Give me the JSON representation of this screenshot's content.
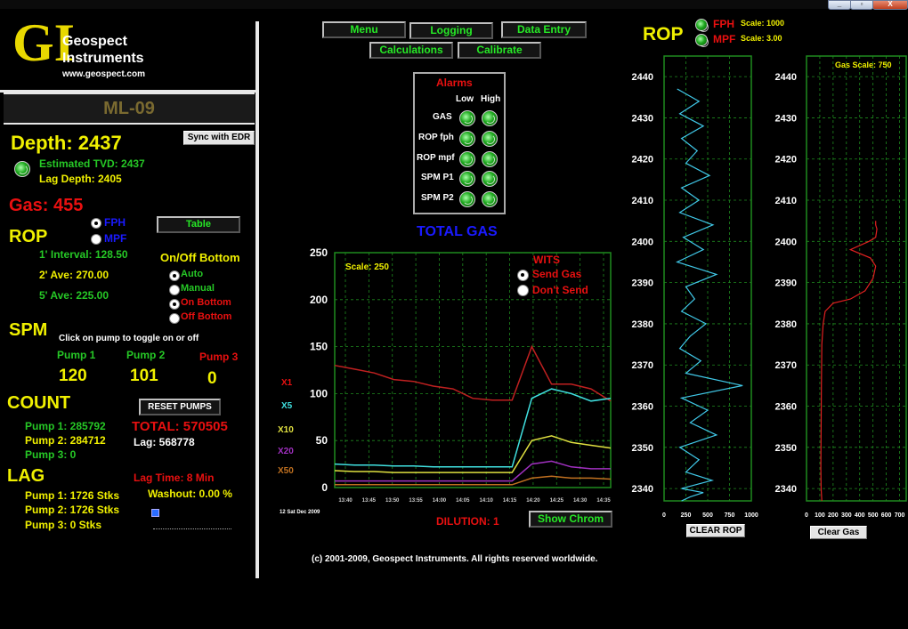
{
  "window_controls": [
    "_",
    "▫",
    "X"
  ],
  "logo": {
    "monogram": "GI",
    "line1": "Geospect",
    "line2": "Instruments",
    "url": "www.geospect.com"
  },
  "well_name": "ML-09",
  "depth": {
    "label": "Depth: 2437",
    "sync_button": "Sync with EDR",
    "estimated_tvd": "Estimated TVD: 2437",
    "lag_depth": "Lag Depth: 2405"
  },
  "gas": {
    "label": "Gas: 455"
  },
  "rop": {
    "title": "ROP",
    "unit_fph": "FPH",
    "unit_mpf": "MPF",
    "table_button": "Table",
    "interval": "1' Interval: 128.50",
    "ave2": "2'  Ave: 270.00",
    "ave5": "5' Ave: 225.00"
  },
  "onoff": {
    "title": "On/Off Bottom",
    "options": [
      "Auto",
      "Manual",
      "On Bottom",
      "Off Bottom"
    ]
  },
  "spm": {
    "title": "SPM",
    "hint": "Click on pump to toggle on or off",
    "pumps": [
      {
        "label": "Pump 1",
        "value": "120"
      },
      {
        "label": "Pump 2",
        "value": "101"
      },
      {
        "label": "Pump 3",
        "value": "0"
      }
    ]
  },
  "count": {
    "title": "COUNT",
    "reset_button": "RESET PUMPS",
    "pump1": "Pump 1: 285792",
    "pump2": "Pump 2: 284712",
    "pump3": "Pump 3: 0",
    "total": "TOTAL: 570505",
    "lag": "Lag: 568778"
  },
  "lag": {
    "title": "LAG",
    "pump1": "Pump 1: 1726 Stks",
    "pump2": "Pump 2: 1726 Stks",
    "pump3": "Pump 3: 0 Stks",
    "lag_time": "Lag Time: 8 Min",
    "washout": "Washout: 0.00 %"
  },
  "menu": {
    "items": [
      "Menu",
      "Logging",
      "Data Entry",
      "Calculations",
      "Calibrate"
    ]
  },
  "alarms": {
    "title": "Alarms",
    "low": "Low",
    "high": "High",
    "rows": [
      "GAS",
      "ROP fph",
      "ROP mpf",
      "SPM P1",
      "SPM P2"
    ]
  },
  "total_gas": {
    "title": "TOTAL GAS",
    "scale": "Scale: 250",
    "wits": "WITS",
    "send_gas": "Send Gas",
    "dont_send": "Don't Send",
    "dilution": "DILUTION: 1",
    "show_chrom": "Show Chrom",
    "date_label": "12 Sat Dec 2009",
    "multipliers": [
      "X1",
      "X5",
      "X10",
      "X20",
      "X50"
    ]
  },
  "rop_header": {
    "title": "ROP",
    "fph": "FPH",
    "mpf": "MPF",
    "scale_fph": "Scale: 1000",
    "scale_mpf": "Scale: 3.00"
  },
  "gas_track": {
    "scale": "Gas Scale: 750",
    "clear_button": "Clear Gas"
  },
  "rop_track": {
    "clear_button": "CLEAR ROP"
  },
  "footer": {
    "copyright": "(c) 2001-2009, Geospect Instruments. All rights reserved worldwide."
  },
  "colors": {
    "background": "#000000",
    "label_yellow": "#f0f000",
    "value_green": "#26c826",
    "alarm_red": "#e81010",
    "grid_green": "#1f8a1f",
    "rop_trace": "#40c8e8",
    "gas_trace": "#e02020"
  },
  "chart_data": [
    {
      "type": "line",
      "title": "TOTAL GAS",
      "ylim": [
        0,
        250
      ],
      "yticks": [
        0,
        50,
        100,
        150,
        200,
        250
      ],
      "x": [
        "13:40",
        "13:45",
        "13:50",
        "13:55",
        "14:00",
        "14:05",
        "14:10",
        "14:15",
        "14:20",
        "14:25",
        "14:30",
        "14:35"
      ],
      "series": [
        {
          "color": "#c02020",
          "values": [
            130,
            126,
            122,
            115,
            113,
            108,
            105,
            95,
            93,
            93,
            150,
            110,
            110,
            105,
            92
          ]
        },
        {
          "color": "#40e0e0",
          "values": [
            25,
            24,
            24,
            23,
            23,
            22,
            22,
            22,
            22,
            22,
            95,
            105,
            100,
            92,
            95
          ]
        },
        {
          "color": "#e0e040",
          "values": [
            18,
            17,
            17,
            16,
            16,
            16,
            16,
            16,
            16,
            16,
            50,
            55,
            48,
            45,
            42
          ]
        },
        {
          "color": "#a030c0",
          "values": [
            7,
            7,
            7,
            7,
            7,
            7,
            7,
            7,
            7,
            7,
            25,
            28,
            22,
            20,
            20
          ]
        },
        {
          "color": "#c07020",
          "values": [
            3,
            3,
            3,
            3,
            3,
            3,
            3,
            3,
            3,
            3,
            10,
            12,
            10,
            10,
            9
          ]
        }
      ]
    },
    {
      "type": "line",
      "title": "ROP",
      "xlim": [
        0,
        1000
      ],
      "xticks": [
        0,
        250,
        500,
        750,
        1000
      ],
      "ylim": [
        2337,
        2445
      ],
      "yticks": [
        2340,
        2350,
        2360,
        2370,
        2380,
        2390,
        2400,
        2410,
        2420,
        2430,
        2440
      ],
      "series": [
        {
          "name": "FPH",
          "color": "#40c8e8",
          "x": [
            150,
            400,
            180,
            450,
            200,
            380,
            250,
            520,
            200,
            400,
            180,
            560,
            220,
            450,
            150,
            600,
            250,
            350,
            200,
            480,
            300,
            180,
            420,
            250,
            900,
            200,
            500,
            300,
            600,
            180,
            400,
            250,
            550,
            200,
            450,
            300,
            200
          ],
          "y": [
            2437,
            2434,
            2431,
            2428,
            2425,
            2422,
            2419,
            2416,
            2413,
            2410,
            2407,
            2404,
            2401,
            2398,
            2395,
            2392,
            2389,
            2386,
            2383,
            2380,
            2377,
            2374,
            2371,
            2368,
            2365,
            2362,
            2359,
            2356,
            2353,
            2350,
            2347,
            2344,
            2342,
            2340,
            2339,
            2338,
            2337
          ]
        }
      ]
    },
    {
      "type": "line",
      "title": "Gas",
      "xlim": [
        0,
        750
      ],
      "xticks": [
        0,
        100,
        200,
        300,
        400,
        500,
        600,
        700
      ],
      "ylim": [
        2337,
        2445
      ],
      "yticks": [
        2340,
        2350,
        2360,
        2370,
        2380,
        2390,
        2400,
        2410,
        2420,
        2430,
        2440
      ],
      "series": [
        {
          "name": "Gas",
          "color": "#e02020",
          "x": [
            115,
            110,
            108,
            110,
            112,
            115,
            125,
            140,
            200,
            330,
            440,
            500,
            520,
            480,
            330,
            470,
            520,
            530,
            520,
            520
          ],
          "y": [
            2337,
            2340,
            2345,
            2355,
            2365,
            2375,
            2380,
            2383,
            2385,
            2386,
            2388,
            2391,
            2394,
            2396,
            2398,
            2400,
            2401,
            2403,
            2404,
            2405
          ]
        }
      ]
    }
  ]
}
